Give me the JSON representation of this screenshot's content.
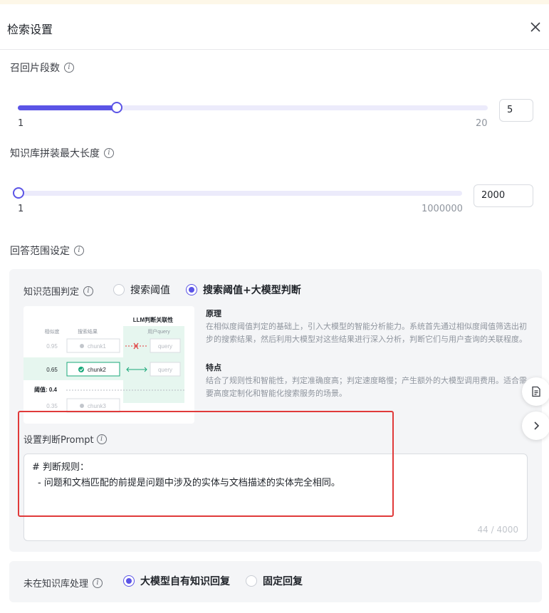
{
  "dialog": {
    "title": "检索设置"
  },
  "recall": {
    "label": "召回片段数",
    "min": "1",
    "max": "20",
    "value": "5",
    "fraction": 0.2105
  },
  "max_length": {
    "label": "知识库拼装最大长度",
    "min": "1",
    "max": "1000000",
    "value": "2000",
    "fraction": 0.002
  },
  "answer_scope": {
    "label": "回答范围设定"
  },
  "knowledge_scope": {
    "label": "知识范围判定",
    "options": [
      "搜索阈值",
      "搜索阈值+大模型判断"
    ],
    "selected": "搜索阈值+大模型判断"
  },
  "diagram": {
    "title": "LLM判断关联性",
    "col_similarity": "相似度",
    "col_results": "搜索结果",
    "col_query": "用户query",
    "rows": [
      {
        "score": "0.95",
        "chunk": "chunk1",
        "query": "query"
      },
      {
        "score": "0.65",
        "chunk": "chunk2",
        "query": "query"
      },
      {
        "score": "0.35",
        "chunk": "chunk3"
      }
    ],
    "threshold_label": "阈值: 0.4"
  },
  "principle": {
    "heading": "原理",
    "text": "在相似度阈值判定的基础上，引入大模型的智能分析能力。系统首先通过相似度阈值筛选出初步的搜索结果，然后利用大模型对这些结果进行深入分析，判断它们与用户查询的关联程度。"
  },
  "feature": {
    "heading": "特点",
    "text": "结合了规则性和智能性，判定准确度高；判定速度略慢；产生额外的大模型调用费用。适合需要高度定制化和智能化搜索服务的场景。"
  },
  "prompt": {
    "label": "设置判断Prompt",
    "line1": "# 判断规则：",
    "line2": "- 问题和文档匹配的前提是问题中涉及的实体与文档描述的实体完全相同。",
    "count": "44 / 4000"
  },
  "not_in_kb": {
    "label": "未在知识库处理",
    "options": [
      "大模型自有知识回复",
      "固定回复"
    ],
    "selected": "大模型自有知识回复"
  },
  "colors": {
    "accent": "#5b54e6",
    "highlight": "#e03a3a",
    "green": "#1aa87a"
  },
  "icons": [
    "close-icon",
    "info-icon",
    "document-icon",
    "chevron-right-icon",
    "check-circle-icon",
    "cross-icon"
  ]
}
